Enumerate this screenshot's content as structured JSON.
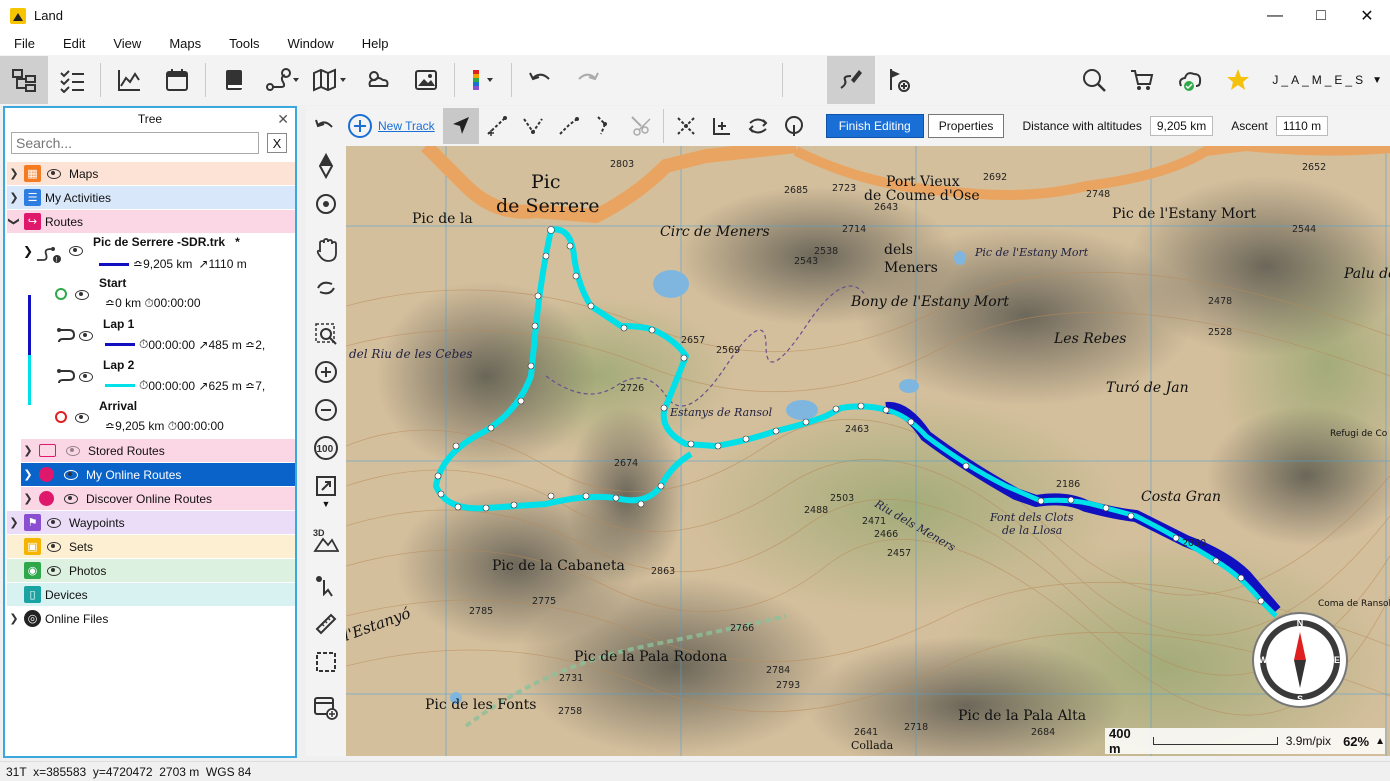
{
  "app": {
    "title": "Land"
  },
  "menu": [
    "File",
    "Edit",
    "View",
    "Maps",
    "Tools",
    "Window",
    "Help"
  ],
  "user": {
    "name": "J_A_M_E_S"
  },
  "tree": {
    "title": "Tree",
    "search_placeholder": "Search...",
    "clear_label": "X",
    "categories": [
      {
        "label": "Maps",
        "color": "#f47b20"
      },
      {
        "label": "My Activities",
        "color": "#2e7de1"
      },
      {
        "label": "Routes",
        "color": "#e0186c"
      }
    ],
    "route": {
      "name": "Pic de Serrere -SDR.trk",
      "modified_mark": "*",
      "distance": "9,205 km",
      "altitude": "1110 m",
      "start": {
        "label": "Start",
        "distance": "0 km",
        "time": "00:00:00"
      },
      "lap1": {
        "label": "Lap 1",
        "time": "00:00:00",
        "ascent": "485 m",
        "extra": "2,"
      },
      "lap2": {
        "label": "Lap 2",
        "time": "00:00:00",
        "ascent": "625 m",
        "extra": "7,"
      },
      "arrival": {
        "label": "Arrival",
        "distance": "9,205 km",
        "time": "00:00:00"
      }
    },
    "route_folders": [
      {
        "label": "Stored Routes"
      },
      {
        "label": "My Online Routes"
      },
      {
        "label": "Discover Online Routes"
      }
    ],
    "more_categories": [
      {
        "label": "Waypoints",
        "color": "#8a4fd0"
      },
      {
        "label": "Sets",
        "color": "#f4b400"
      },
      {
        "label": "Photos",
        "color": "#2ea84a"
      },
      {
        "label": "Devices",
        "color": "#1aa3a3"
      },
      {
        "label": "Online Files",
        "color": "#222222"
      }
    ]
  },
  "map_toolbar": {
    "new_track": "New Track",
    "finish_editing": "Finish Editing",
    "properties": "Properties",
    "distance_label": "Distance with altitudes",
    "distance_value": "9,205 km",
    "ascent_label": "Ascent",
    "ascent_value": "1110 m"
  },
  "map_labels": {
    "pic_1": "Pic",
    "pic_2": "de Serrere",
    "pic_la": "Pic de la",
    "port_vieux": "Port Vieux",
    "coume": "de Coume d'Ose",
    "estany_mort": "Pic de l'Estany Mort",
    "circ": "Circ de Meners",
    "dels": "dels",
    "meners": "Meners",
    "bony": "Bony de l'Estany Mort",
    "rebes": "Les Rebes",
    "turo": "Turó de Jan",
    "costa": "Costa Gran",
    "cabaneta": "Pic de la Cabaneta",
    "pala_rodona": "Pic de la Pala Rodona",
    "fonts": "Pic de les Fonts",
    "pala_alta": "Pic de la Pala Alta",
    "estanyo": "l'Estanyó",
    "ferran": "del Riu de les Cebes",
    "rasol": "Estanys de Ransol",
    "font": "Font dels Clots",
    "llosa": "de la Llosa",
    "riu": "Riu dels Meners",
    "refugi": "Refugi de Co",
    "coma": "Coma de Ransol",
    "collada": "Collada",
    "palu": "Palu de",
    "e2803": "2803",
    "e2685": "2685",
    "e2723": "2723",
    "e2714": "2714",
    "e2692": "2692",
    "e2748": "2748",
    "e2652": "2652",
    "e2538": "2538",
    "e2543": "2543",
    "e2657": "2657",
    "e2569": "2569",
    "e2726": "2726",
    "e2674": "2674",
    "e2463": "2463",
    "e2503": "2503",
    "e2488": "2488",
    "e2471": "2471",
    "e2466": "2466",
    "e2457": "2457",
    "e2863": "2863",
    "e2775": "2775",
    "e2785": "2785",
    "e2766": "2766",
    "e2784": "2784",
    "e2793": "2793",
    "e2758": "2758",
    "e2731": "2731",
    "e2718": "2718",
    "e2641": "2641",
    "e2684": "2684",
    "e2478": "2478",
    "e2528": "2528",
    "e2186": "2186",
    "e2050": "2050",
    "e2544": "2544",
    "e2643": "2643",
    "pic_la_2": "Pic de la"
  },
  "scale": {
    "distance": "400 m",
    "resolution": "3.9m/pix",
    "zoom": "62%"
  },
  "compass": {
    "n": "N",
    "s": "S",
    "e": "E",
    "w": "W"
  },
  "status": {
    "text": "31T  x=385583  y=4720472  2703 m  WGS 84"
  }
}
